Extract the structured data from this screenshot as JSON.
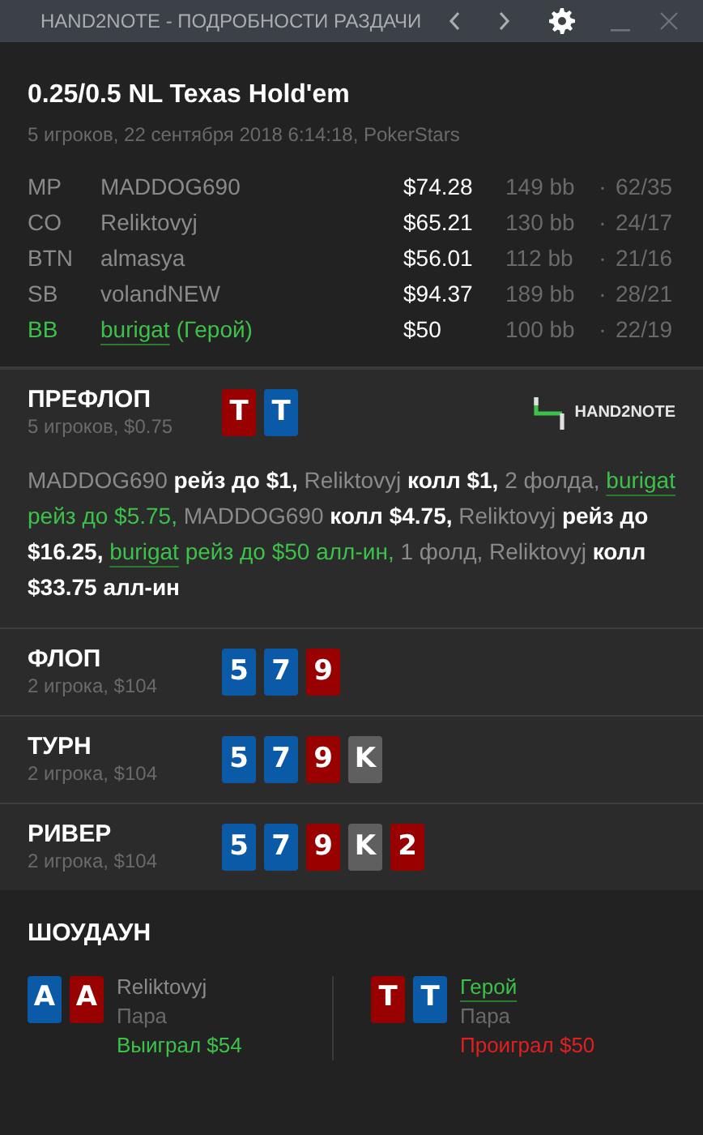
{
  "window": {
    "title": "HAND2NOTE - ПОДРОБНОСТИ РАЗДАЧИ"
  },
  "hand": {
    "title": "0.25/0.5 NL Texas Hold'em",
    "subtitle": "5 игроков, 22 сентября 2018 6:14:18, PokerStars"
  },
  "players": [
    {
      "position": "MP",
      "name": "MADDOG690",
      "stack": "$74.28",
      "bb": "149 bb",
      "separator": "·",
      "stats": "62/35",
      "hero": false
    },
    {
      "position": "CO",
      "name": "Reliktovyj",
      "stack": "$65.21",
      "bb": "130 bb",
      "separator": "·",
      "stats": "24/17",
      "hero": false
    },
    {
      "position": "BTN",
      "name": "almasya",
      "stack": "$56.01",
      "bb": "112 bb",
      "separator": "·",
      "stats": "21/16",
      "hero": false
    },
    {
      "position": "SB",
      "name": "volandNEW",
      "stack": "$94.37",
      "bb": "189 bb",
      "separator": "·",
      "stats": "28/21",
      "hero": false
    },
    {
      "position": "BB",
      "name": "burigat",
      "tag": "(Герой)",
      "stack": "$50",
      "bb": "100 bb",
      "separator": "·",
      "stats": "22/19",
      "hero": true
    }
  ],
  "streets": [
    {
      "name": "ПРЕФЛОП",
      "info": "5 игроков, $0.75",
      "cards": [
        {
          "rank": "T",
          "color": "#990000"
        },
        {
          "rank": "T",
          "color": "#0b5aa8"
        }
      ],
      "logo": "HAND2NOTE",
      "actions": [
        {
          "kind": "player",
          "text": "MADDOG690"
        },
        {
          "kind": "action",
          "text": "рейз до $1,"
        },
        {
          "kind": "player",
          "text": "Reliktovyj"
        },
        {
          "kind": "action",
          "text": "колл $1,"
        },
        {
          "kind": "plain",
          "text": "2 фолда,"
        },
        {
          "kind": "hero",
          "text": "burigat"
        },
        {
          "kind": "hero_action",
          "text": "рейз до $5.75,"
        },
        {
          "kind": "player",
          "text": "MADDOG690"
        },
        {
          "kind": "action",
          "text": "колл $4.75,"
        },
        {
          "kind": "player",
          "text": "Reliktovyj"
        },
        {
          "kind": "action",
          "text": "рейз до $16.25,"
        },
        {
          "kind": "hero",
          "text": "burigat"
        },
        {
          "kind": "hero_action",
          "text": "рейз до $50 алл-ин,"
        },
        {
          "kind": "plain",
          "text": "1 фолд,"
        },
        {
          "kind": "player",
          "text": "Reliktovyj"
        },
        {
          "kind": "action",
          "text": "колл $33.75 алл-ин"
        }
      ]
    },
    {
      "name": "ФЛОП",
      "info": "2 игрока, $104",
      "cards": [
        {
          "rank": "5",
          "color": "#0b5aa8"
        },
        {
          "rank": "7",
          "color": "#0b5aa8"
        },
        {
          "rank": "9",
          "color": "#990000"
        }
      ]
    },
    {
      "name": "ТУРН",
      "info": "2 игрока, $104",
      "cards": [
        {
          "rank": "5",
          "color": "#0b5aa8"
        },
        {
          "rank": "7",
          "color": "#0b5aa8"
        },
        {
          "rank": "9",
          "color": "#990000"
        },
        {
          "rank": "K",
          "color": "#5f5f5f"
        }
      ]
    },
    {
      "name": "РИВЕР",
      "info": "2 игрока, $104",
      "cards": [
        {
          "rank": "5",
          "color": "#0b5aa8"
        },
        {
          "rank": "7",
          "color": "#0b5aa8"
        },
        {
          "rank": "9",
          "color": "#990000"
        },
        {
          "rank": "K",
          "color": "#5f5f5f"
        },
        {
          "rank": "2",
          "color": "#990000"
        }
      ]
    }
  ],
  "showdown": {
    "title": "ШОУДАУН",
    "hands": [
      {
        "cards": [
          {
            "rank": "A",
            "color": "#0b5aa8"
          },
          {
            "rank": "A",
            "color": "#990000"
          }
        ],
        "name": "Reliktovyj",
        "hero": false,
        "combo": "Пара",
        "result": "Выиграл $54",
        "kind": "won"
      },
      {
        "cards": [
          {
            "rank": "T",
            "color": "#990000"
          },
          {
            "rank": "T",
            "color": "#0b5aa8"
          }
        ],
        "name": "Герой",
        "hero": true,
        "combo": "Пара",
        "result": "Проиграл $50",
        "kind": "lost"
      }
    ]
  }
}
